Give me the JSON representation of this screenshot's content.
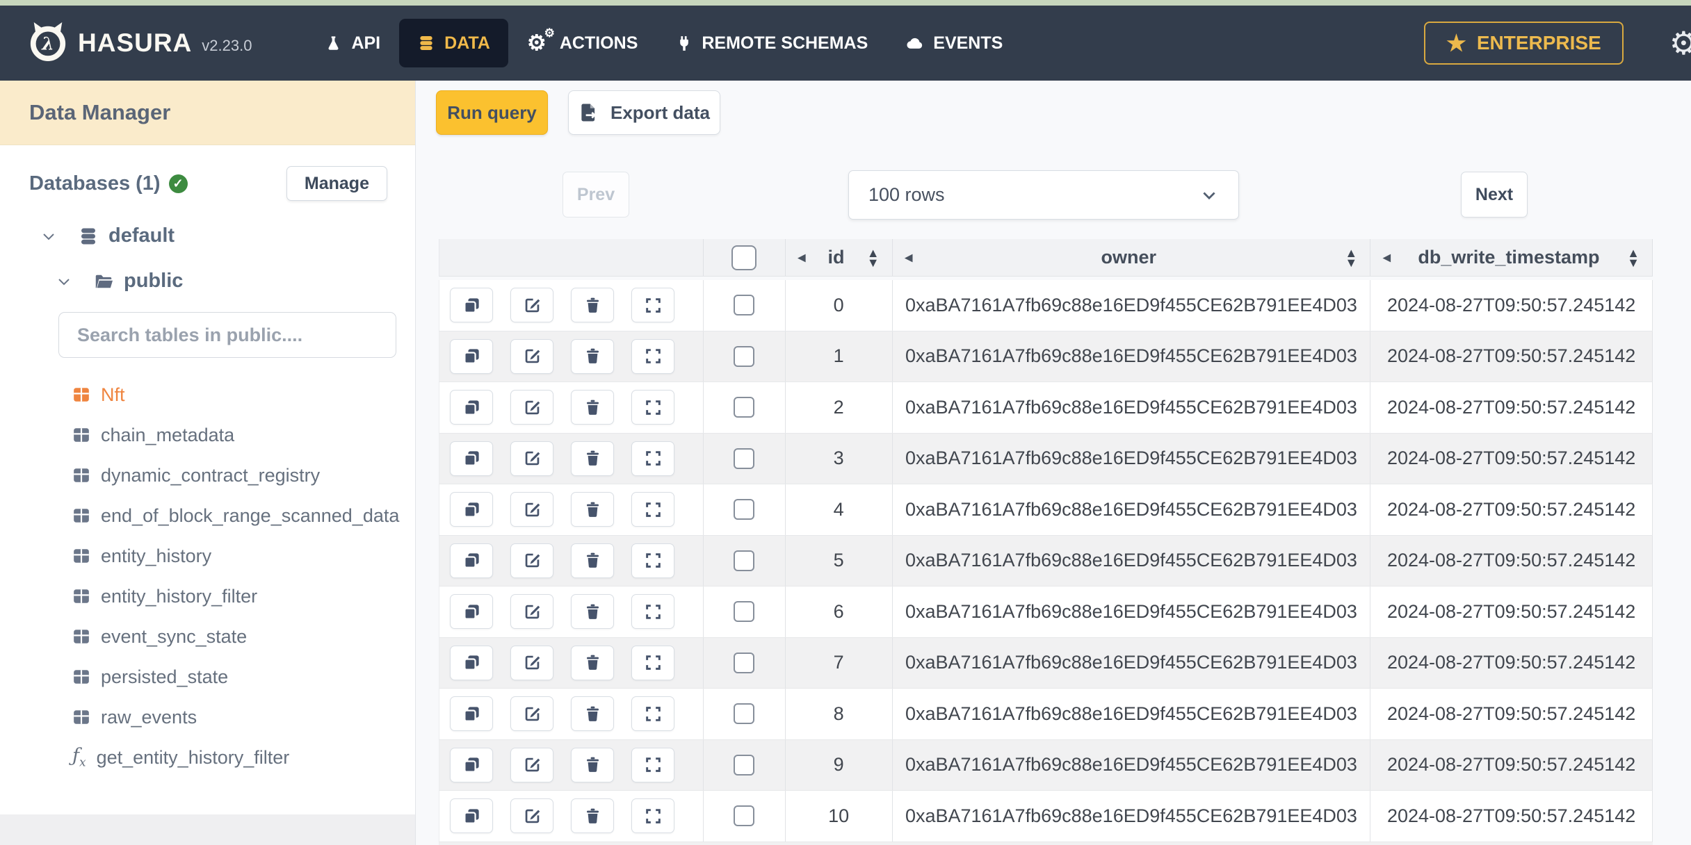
{
  "colors": {
    "top_strip": "#C7D6BC",
    "navbar_bg": "#333D4C",
    "active_tab_bg": "#141B2A",
    "brand_yellow": "#F0B94A",
    "enterprise_gold": "#EDBA4E",
    "sidebar_header_bg": "#FAEBCB",
    "selected_table_orange": "#EF8540",
    "run_query_yellow": "#FBC12F",
    "success_green": "#3D8B40",
    "slate_text": "#5A6577"
  },
  "navbar": {
    "brand": "HASURA",
    "version": "v2.23.0",
    "items": [
      {
        "label": "API",
        "icon": "flask-icon",
        "active": false
      },
      {
        "label": "DATA",
        "icon": "database-icon",
        "active": true
      },
      {
        "label": "ACTIONS",
        "icon": "gears-icon",
        "active": false
      },
      {
        "label": "REMOTE SCHEMAS",
        "icon": "plug-icon",
        "active": false
      },
      {
        "label": "EVENTS",
        "icon": "cloud-icon",
        "active": false
      }
    ],
    "enterprise": {
      "label": "ENTERPRISE",
      "icon": "star-icon"
    },
    "settings_icon": "gear-icon"
  },
  "sidebar": {
    "title": "Data Manager",
    "databases": {
      "label": "Databases (1)",
      "status_icon": "check-circle-icon",
      "manage_label": "Manage"
    },
    "tree": {
      "database": "default",
      "schema": "public"
    },
    "search": {
      "placeholder": "Search tables in public...."
    },
    "tables": [
      {
        "label": "Nft",
        "icon": "table-icon",
        "selected": true
      },
      {
        "label": "chain_metadata",
        "icon": "table-icon",
        "selected": false
      },
      {
        "label": "dynamic_contract_registry",
        "icon": "table-icon",
        "selected": false
      },
      {
        "label": "end_of_block_range_scanned_data",
        "icon": "table-icon",
        "selected": false
      },
      {
        "label": "entity_history",
        "icon": "table-icon",
        "selected": false
      },
      {
        "label": "entity_history_filter",
        "icon": "table-icon",
        "selected": false
      },
      {
        "label": "event_sync_state",
        "icon": "table-icon",
        "selected": false
      },
      {
        "label": "persisted_state",
        "icon": "table-icon",
        "selected": false
      },
      {
        "label": "raw_events",
        "icon": "table-icon",
        "selected": false
      },
      {
        "label": "get_entity_history_filter",
        "icon": "function-icon",
        "selected": false
      }
    ]
  },
  "toolbar": {
    "run_query_label": "Run query",
    "export_data_label": "Export data"
  },
  "pagination": {
    "prev_label": "Prev",
    "rows_value": "100 rows",
    "next_label": "Next"
  },
  "grid": {
    "columns": [
      {
        "key": "id",
        "label": "id",
        "sortable": true
      },
      {
        "key": "owner",
        "label": "owner",
        "sortable": true
      },
      {
        "key": "db_write_timestamp",
        "label": "db_write_timestamp",
        "sortable": true
      }
    ],
    "row_actions": [
      "clone",
      "edit",
      "delete",
      "expand"
    ],
    "rows": [
      {
        "id": "0",
        "owner": "0xaBA7161A7fb69c88e16ED9f455CE62B791EE4D03",
        "db_write_timestamp": "2024-08-27T09:50:57.245142"
      },
      {
        "id": "1",
        "owner": "0xaBA7161A7fb69c88e16ED9f455CE62B791EE4D03",
        "db_write_timestamp": "2024-08-27T09:50:57.245142"
      },
      {
        "id": "2",
        "owner": "0xaBA7161A7fb69c88e16ED9f455CE62B791EE4D03",
        "db_write_timestamp": "2024-08-27T09:50:57.245142"
      },
      {
        "id": "3",
        "owner": "0xaBA7161A7fb69c88e16ED9f455CE62B791EE4D03",
        "db_write_timestamp": "2024-08-27T09:50:57.245142"
      },
      {
        "id": "4",
        "owner": "0xaBA7161A7fb69c88e16ED9f455CE62B791EE4D03",
        "db_write_timestamp": "2024-08-27T09:50:57.245142"
      },
      {
        "id": "5",
        "owner": "0xaBA7161A7fb69c88e16ED9f455CE62B791EE4D03",
        "db_write_timestamp": "2024-08-27T09:50:57.245142"
      },
      {
        "id": "6",
        "owner": "0xaBA7161A7fb69c88e16ED9f455CE62B791EE4D03",
        "db_write_timestamp": "2024-08-27T09:50:57.245142"
      },
      {
        "id": "7",
        "owner": "0xaBA7161A7fb69c88e16ED9f455CE62B791EE4D03",
        "db_write_timestamp": "2024-08-27T09:50:57.245142"
      },
      {
        "id": "8",
        "owner": "0xaBA7161A7fb69c88e16ED9f455CE62B791EE4D03",
        "db_write_timestamp": "2024-08-27T09:50:57.245142"
      },
      {
        "id": "9",
        "owner": "0xaBA7161A7fb69c88e16ED9f455CE62B791EE4D03",
        "db_write_timestamp": "2024-08-27T09:50:57.245142"
      },
      {
        "id": "10",
        "owner": "0xaBA7161A7fb69c88e16ED9f455CE62B791EE4D03",
        "db_write_timestamp": "2024-08-27T09:50:57.245142"
      }
    ]
  }
}
